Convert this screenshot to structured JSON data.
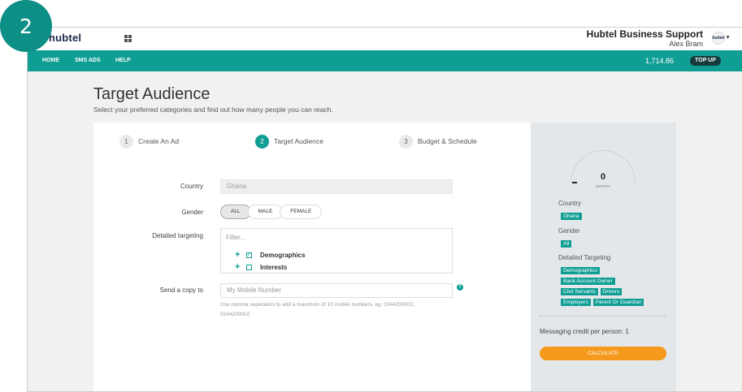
{
  "step_badge": "2",
  "topbar": {
    "logo": "hubtel",
    "apps_icon": "grid-icon",
    "account_name": "Hubtel Business Support",
    "account_user": "Alex Bram",
    "avatar_text": "hubtel"
  },
  "nav": {
    "items": [
      "HOME",
      "SMS ADS",
      "HELP"
    ],
    "balance": "1,714.86",
    "topup_label": "TOP UP"
  },
  "page": {
    "title": "Target Audience",
    "subtitle": "Select your preferred categories and find out how many people you can reach."
  },
  "steps": [
    {
      "num": "1",
      "label": "Create An Ad"
    },
    {
      "num": "2",
      "label": "Target Audience"
    },
    {
      "num": "3",
      "label": "Budget & Schedule"
    }
  ],
  "form": {
    "country_label": "Country",
    "country_value": "Ghana",
    "gender_label": "Gender",
    "gender_options": [
      "ALL",
      "MALE",
      "FEMALE"
    ],
    "gender_selected": "ALL",
    "targeting_label": "Detailed targeting",
    "filter_placeholder": "Filter...",
    "tree": [
      {
        "label": "Demographics",
        "checked": true
      },
      {
        "label": "Interests",
        "checked": false
      }
    ],
    "copy_label": "Send a copy to",
    "copy_placeholder": "My Mobile Number",
    "hint_line1": "Use comma separators to add a maximum of 10 mobile numbers. eg. 0244200001,",
    "hint_line2": "0244200002"
  },
  "summary": {
    "reach_value": "0",
    "reach_unit": "persons",
    "country_label": "Country",
    "country_tags": [
      "Ghana"
    ],
    "gender_label": "Gender",
    "gender_tags": [
      "All"
    ],
    "targeting_label": "Detailed Targeting",
    "targeting_tags": [
      "Demographics",
      "Bank Account Owner",
      "Civil Servants",
      "Drivers",
      "Employers",
      "Parent Or Guardian"
    ],
    "credit_text": "Messaging credit per person: 1",
    "calculate_label": "CALCULATE"
  },
  "colors": {
    "teal": "#0f9e94",
    "orange": "#f59a1d",
    "topup": "#153a3a"
  }
}
